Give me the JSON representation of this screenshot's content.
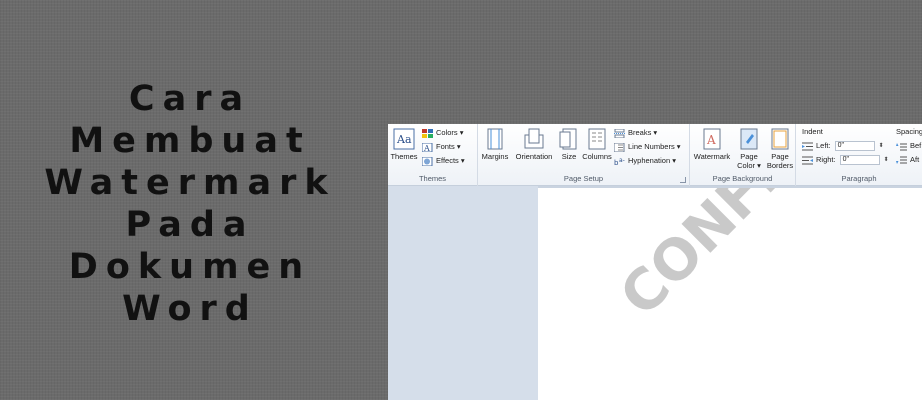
{
  "headline": [
    "Cara Membuat",
    "Watermark",
    "Pada Dokumen",
    "Word"
  ],
  "ribbon": {
    "themes": {
      "themes_label": "Themes",
      "colors_label": "Colors ▾",
      "fonts_label": "Fonts ▾",
      "effects_label": "Effects ▾",
      "group_label": "Themes"
    },
    "page_setup": {
      "margins_label": "Margins",
      "orientation_label": "Orientation",
      "size_label": "Size",
      "columns_label": "Columns",
      "breaks_label": "Breaks ▾",
      "line_numbers_label": "Line Numbers ▾",
      "hyphenation_label": "Hyphenation ▾",
      "group_label": "Page Setup"
    },
    "page_background": {
      "watermark_label": "Watermark",
      "page_color_label": "Page Color ▾",
      "page_borders_label": "Page Borders",
      "group_label": "Page Background"
    },
    "paragraph": {
      "indent_label": "Indent",
      "left_label": "Left:",
      "left_value": "0\"",
      "right_label": "Right:",
      "right_value": "0\"",
      "spacing_label": "Spacing",
      "before_label": "Bef",
      "after_label": "Aft",
      "group_label": "Paragraph"
    }
  },
  "document": {
    "watermark_text": "CONFIDENTIAL"
  },
  "colors": {
    "background": "#6b6b6b",
    "headline": "#111111",
    "ribbon": "#eef2f7",
    "nav_pane": "#d5deea",
    "watermark": "#c9c9c9"
  }
}
